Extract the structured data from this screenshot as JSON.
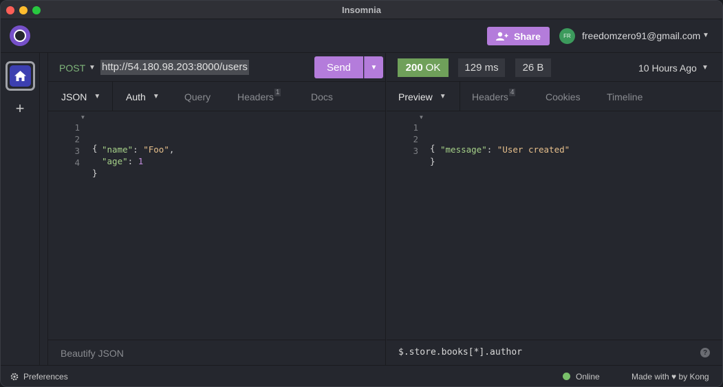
{
  "window": {
    "title": "Insomnia"
  },
  "header": {
    "share_label": "Share",
    "avatar_initials": "FR",
    "user_email": "freedomzero91@gmail.com"
  },
  "request": {
    "method": "POST",
    "url": "http://54.180.98.203:8000/users",
    "send_label": "Send",
    "tabs": [
      {
        "label": "JSON",
        "active": true
      },
      {
        "label": "Auth"
      },
      {
        "label": "Query"
      },
      {
        "label": "Headers",
        "badge": "1"
      },
      {
        "label": "Docs"
      }
    ],
    "body_lines": [
      {
        "num": "1",
        "text": "{"
      },
      {
        "num": "2",
        "key": "\"name\"",
        "value": "\"Foo\"",
        "trail": ","
      },
      {
        "num": "3",
        "key": "\"age\"",
        "value": "1"
      },
      {
        "num": "4",
        "text": "}"
      }
    ],
    "footer_label": "Beautify JSON"
  },
  "response": {
    "status_code": "200",
    "status_text": "OK",
    "time": "129 ms",
    "size": "26 B",
    "ago": "10 Hours Ago",
    "tabs": [
      {
        "label": "Preview",
        "active": true
      },
      {
        "label": "Headers",
        "badge": "4"
      },
      {
        "label": "Cookies"
      },
      {
        "label": "Timeline"
      }
    ],
    "body_lines": [
      {
        "num": "1",
        "text": "{"
      },
      {
        "num": "2",
        "key": "\"message\"",
        "value": "\"User created\""
      },
      {
        "num": "3",
        "text": "}"
      }
    ],
    "filter": "$.store.books[*].author",
    "help": "?"
  },
  "statusbar": {
    "preferences": "Preferences",
    "online": "Online",
    "made_with": "Made with",
    "by": "by Kong"
  },
  "colors": {
    "accent": "#b47cdb",
    "status_ok": "#6fa05a",
    "brand": "#7650c9",
    "online": "#79c06a"
  }
}
